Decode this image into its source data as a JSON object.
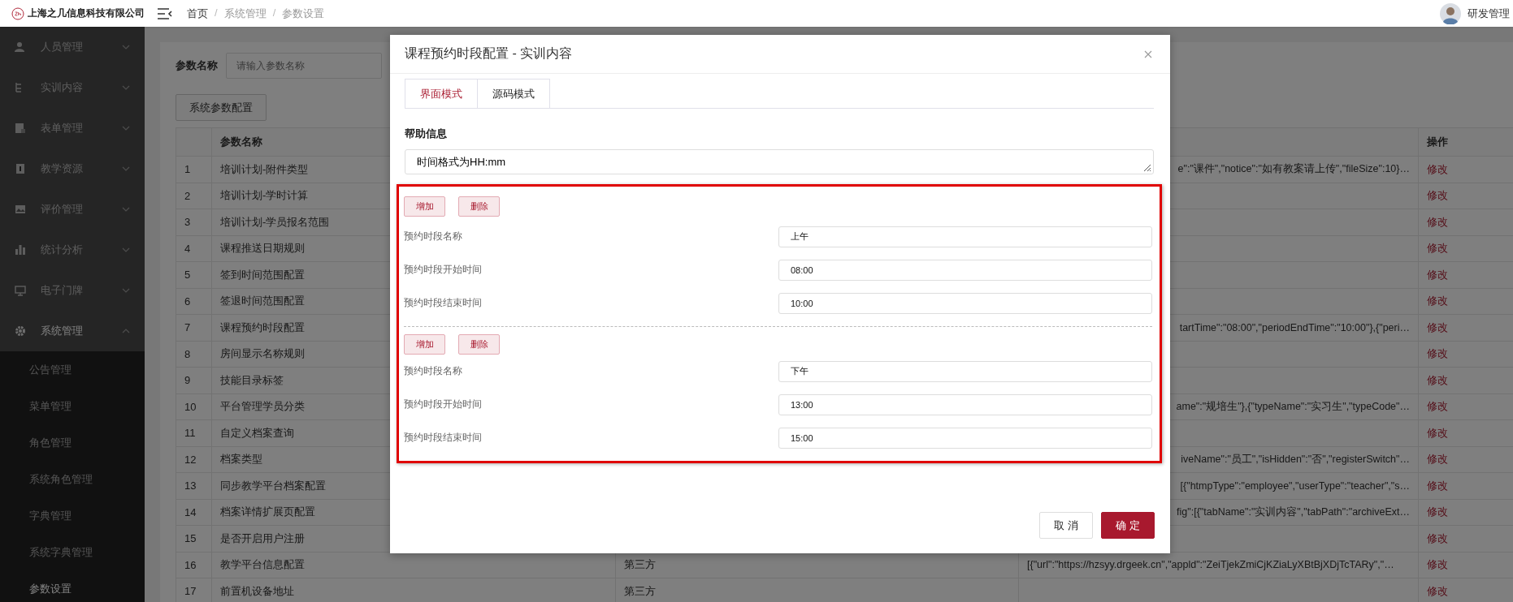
{
  "header": {
    "company": "上海之几信息科技有限公司",
    "breadcrumb": [
      "首页",
      "系统管理",
      "参数设置"
    ],
    "breadcrumb_separator": "/",
    "user": "研发管理"
  },
  "sidebar": {
    "items": [
      {
        "label": "人员管理",
        "expanded": false
      },
      {
        "label": "实训内容",
        "expanded": false
      },
      {
        "label": "表单管理",
        "expanded": false
      },
      {
        "label": "教学资源",
        "expanded": false
      },
      {
        "label": "评价管理",
        "expanded": false
      },
      {
        "label": "统计分析",
        "expanded": false
      },
      {
        "label": "电子门牌",
        "expanded": false
      },
      {
        "label": "系统管理",
        "expanded": true,
        "children": [
          {
            "label": "公告管理",
            "selected": false
          },
          {
            "label": "菜单管理",
            "selected": false
          },
          {
            "label": "角色管理",
            "selected": false
          },
          {
            "label": "系统角色管理",
            "selected": false
          },
          {
            "label": "字典管理",
            "selected": false
          },
          {
            "label": "系统字典管理",
            "selected": false
          },
          {
            "label": "参数设置",
            "selected": true
          }
        ]
      }
    ]
  },
  "search": {
    "label": "参数名称",
    "placeholder": "请输入参数名称"
  },
  "toolbar_button": "系统参数配置",
  "table": {
    "columns": {
      "name": "参数名称",
      "action": "操作"
    },
    "rows": [
      {
        "index": "1",
        "name": "培训计划-附件类型",
        "value": "e\":\"课件\",\"notice\":\"如有教案请上传\",\"fileSize\":10}…",
        "action": "修改"
      },
      {
        "index": "2",
        "name": "培训计划-学时计算",
        "action": "修改"
      },
      {
        "index": "3",
        "name": "培训计划-学员报名范围",
        "action": "修改"
      },
      {
        "index": "4",
        "name": "课程推送日期规则",
        "action": "修改"
      },
      {
        "index": "5",
        "name": "签到时间范围配置",
        "action": "修改"
      },
      {
        "index": "6",
        "name": "签退时间范围配置",
        "action": "修改"
      },
      {
        "index": "7",
        "name": "课程预约时段配置",
        "value": "tartTime\":\"08:00\",\"periodEndTime\":\"10:00\"},{\"peri…",
        "action": "修改"
      },
      {
        "index": "8",
        "name": "房间显示名称规则",
        "action": "修改"
      },
      {
        "index": "9",
        "name": "技能目录标签",
        "action": "修改"
      },
      {
        "index": "10",
        "name": "平台管理学员分类",
        "value": "ame\":\"规培生\"},{\"typeName\":\"实习生\",\"typeCode\"…",
        "action": "修改"
      },
      {
        "index": "11",
        "name": "自定义档案查询",
        "action": "修改"
      },
      {
        "index": "12",
        "name": "档案类型",
        "value": "iveName\":\"员工\",\"isHidden\":\"否\",\"registerSwitch\"…",
        "action": "修改"
      },
      {
        "index": "13",
        "name": "同步教学平台档案配置",
        "value": "[{\"htmpType\":\"employee\",\"userType\":\"teacher\",\"s…",
        "action": "修改"
      },
      {
        "index": "14",
        "name": "档案详情扩展页配置",
        "value": "fig\":[{\"tabName\":\"实训内容\",\"tabPath\":\"archiveExt…",
        "action": "修改"
      },
      {
        "index": "15",
        "name": "是否开启用户注册",
        "action": "修改"
      },
      {
        "index": "16",
        "name": "教学平台信息配置",
        "type": "第三方",
        "value": "[{\"url\":\"https://hzsyy.drgeek.cn\",\"appld\":\"ZeiTjekZmiCjKZiaLyXBtBjXDjTcTARy\",\"…",
        "action": "修改"
      },
      {
        "index": "17",
        "name": "前置机设备地址",
        "type": "第三方",
        "action": "修改"
      }
    ]
  },
  "dialog": {
    "title": "课程预约时段配置 - 实训内容",
    "tabs": [
      {
        "label": "界面模式",
        "selected": true
      },
      {
        "label": "源码模式",
        "selected": false
      }
    ],
    "help_label": "帮助信息",
    "help_text": "时间格式为HH:mm",
    "periods": [
      {
        "buttons": [
          "增加",
          "删除"
        ],
        "fields": [
          {
            "label": "预约时段名称",
            "value": "上午"
          },
          {
            "label": "预约时段开始时间",
            "value": "08:00"
          },
          {
            "label": "预约时段结束时间",
            "value": "10:00"
          }
        ]
      },
      {
        "buttons": [
          "增加",
          "删除"
        ],
        "fields": [
          {
            "label": "预约时段名称",
            "value": "下午"
          },
          {
            "label": "预约时段开始时间",
            "value": "13:00"
          },
          {
            "label": "预约时段结束时间",
            "value": "15:00"
          }
        ]
      }
    ],
    "footer_buttons": [
      {
        "label": "取 消",
        "kind": "secondary"
      },
      {
        "label": "确 定",
        "kind": "primary"
      }
    ]
  }
}
